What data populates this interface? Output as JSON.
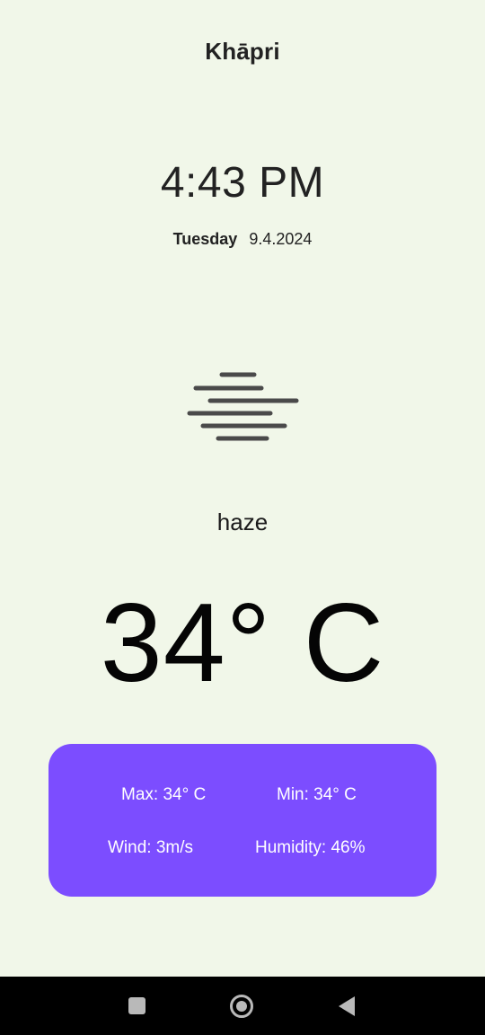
{
  "location": {
    "city": "Khāpri"
  },
  "clock": {
    "time": "4:43 PM",
    "day": "Tuesday",
    "date": "9.4.2024"
  },
  "weather": {
    "icon": "haze-icon",
    "condition": "haze",
    "temperature": "34° C"
  },
  "details": {
    "max": "Max: 34° C",
    "min": "Min: 34° C",
    "wind": "Wind: 3m/s",
    "humidity": "Humidity: 46%"
  },
  "colors": {
    "background": "#f1f7e9",
    "card": "#7c4dff",
    "icon": "#4a4a4a",
    "navbar": "#000000"
  },
  "nav": {
    "recent_icon": "square-icon",
    "home_icon": "circle-icon",
    "back_icon": "triangle-back-icon"
  }
}
